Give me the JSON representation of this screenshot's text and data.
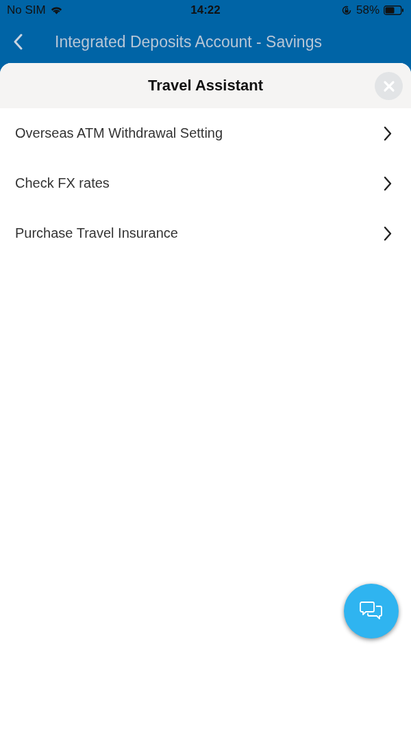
{
  "status_bar": {
    "carrier": "No SIM",
    "time": "14:22",
    "battery": "58%"
  },
  "nav_bar": {
    "title": "Integrated Deposits Account - Savings"
  },
  "sheet": {
    "title": "Travel Assistant"
  },
  "menu_items": [
    {
      "label": "Overseas ATM Withdrawal Setting"
    },
    {
      "label": "Check FX rates"
    },
    {
      "label": "Purchase Travel Insurance"
    }
  ]
}
